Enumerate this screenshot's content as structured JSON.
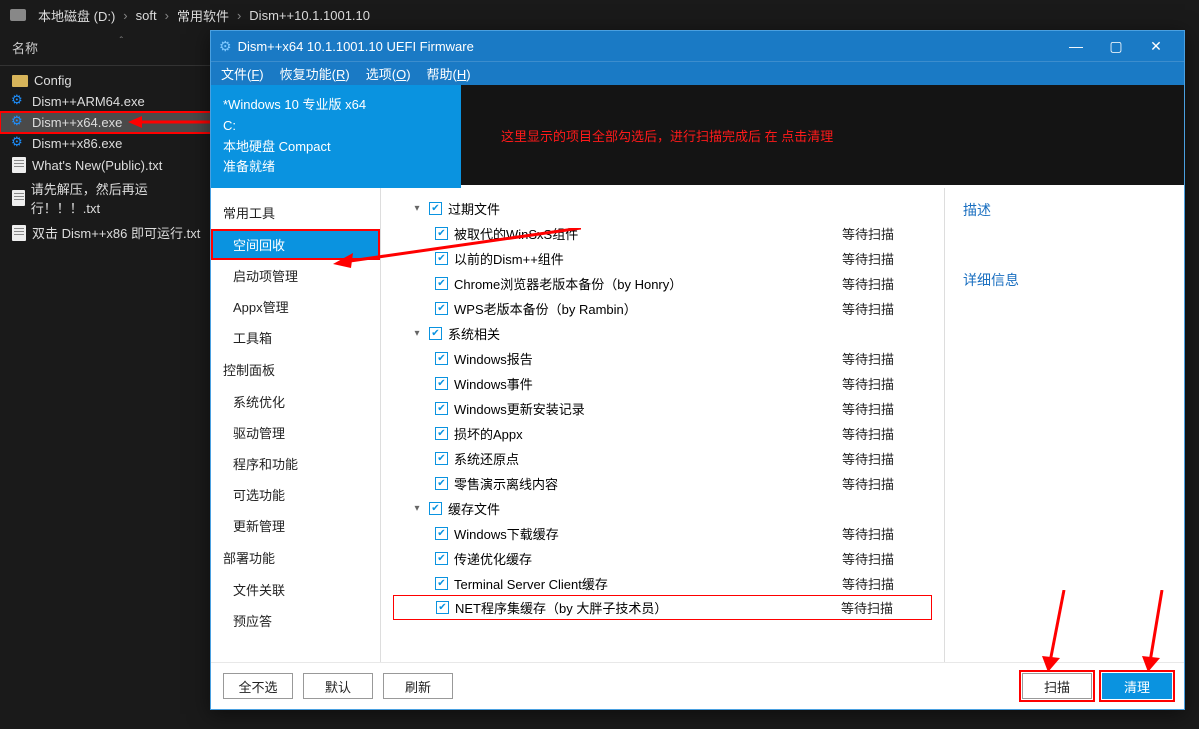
{
  "breadcrumb": [
    "本地磁盘 (D:)",
    "soft",
    "常用软件",
    "Dism++10.1.1001.10"
  ],
  "explorer": {
    "name_header": "名称",
    "files": [
      {
        "icon": "folder",
        "name": "Config"
      },
      {
        "icon": "gear",
        "name": "Dism++ARM64.exe"
      },
      {
        "icon": "gear",
        "name": "Dism++x64.exe",
        "selected": true
      },
      {
        "icon": "gear",
        "name": "Dism++x86.exe"
      },
      {
        "icon": "txt",
        "name": "What's New(Public).txt"
      },
      {
        "icon": "txt",
        "name": "请先解压，然后再运行！！！.txt"
      },
      {
        "icon": "txt",
        "name": "双击 Dism++x86 即可运行.txt"
      }
    ]
  },
  "dism": {
    "title": "Dism++x64 10.1.1001.10 UEFI Firmware",
    "menu": [
      {
        "label": "文件",
        "mn": "F"
      },
      {
        "label": "恢复功能",
        "mn": "R"
      },
      {
        "label": "选项",
        "mn": "O"
      },
      {
        "label": "帮助",
        "mn": "H"
      }
    ],
    "os": {
      "line1": "*Windows 10 专业版 x64",
      "line2": "C:",
      "line3": "本地硬盘 Compact",
      "line4": "准备就绪"
    },
    "annotation": "这里显示的项目全部勾选后，进行扫描完成后 在 点击清理",
    "nav": [
      {
        "type": "group",
        "label": "常用工具"
      },
      {
        "type": "item",
        "label": "空间回收",
        "active": true
      },
      {
        "type": "item",
        "label": "启动项管理"
      },
      {
        "type": "item",
        "label": "Appx管理"
      },
      {
        "type": "item",
        "label": "工具箱"
      },
      {
        "type": "group",
        "label": "控制面板"
      },
      {
        "type": "item",
        "label": "系统优化"
      },
      {
        "type": "item",
        "label": "驱动管理"
      },
      {
        "type": "item",
        "label": "程序和功能"
      },
      {
        "type": "item",
        "label": "可选功能"
      },
      {
        "type": "item",
        "label": "更新管理"
      },
      {
        "type": "group",
        "label": "部署功能"
      },
      {
        "type": "item",
        "label": "文件关联"
      },
      {
        "type": "item",
        "label": "预应答"
      }
    ],
    "status": "等待扫描",
    "groups": [
      {
        "label": "过期文件",
        "items": [
          "被取代的WinSxS组件",
          "以前的Dism++组件",
          "Chrome浏览器老版本备份（by Honry）",
          "WPS老版本备份（by Rambin）"
        ]
      },
      {
        "label": "系统相关",
        "items": [
          "Windows报告",
          "Windows事件",
          "Windows更新安装记录",
          "损坏的Appx",
          "系统还原点",
          "零售演示离线内容"
        ]
      },
      {
        "label": "缓存文件",
        "items": [
          "Windows下载缓存",
          "传递优化缓存",
          "Terminal Server Client缓存",
          "NET程序集缓存（by 大胖子技术员）"
        ]
      }
    ],
    "info": {
      "h1": "描述",
      "h2": "详细信息"
    },
    "buttons": {
      "none": "全不选",
      "default": "默认",
      "refresh": "刷新",
      "scan": "扫描",
      "clean": "清理"
    }
  }
}
